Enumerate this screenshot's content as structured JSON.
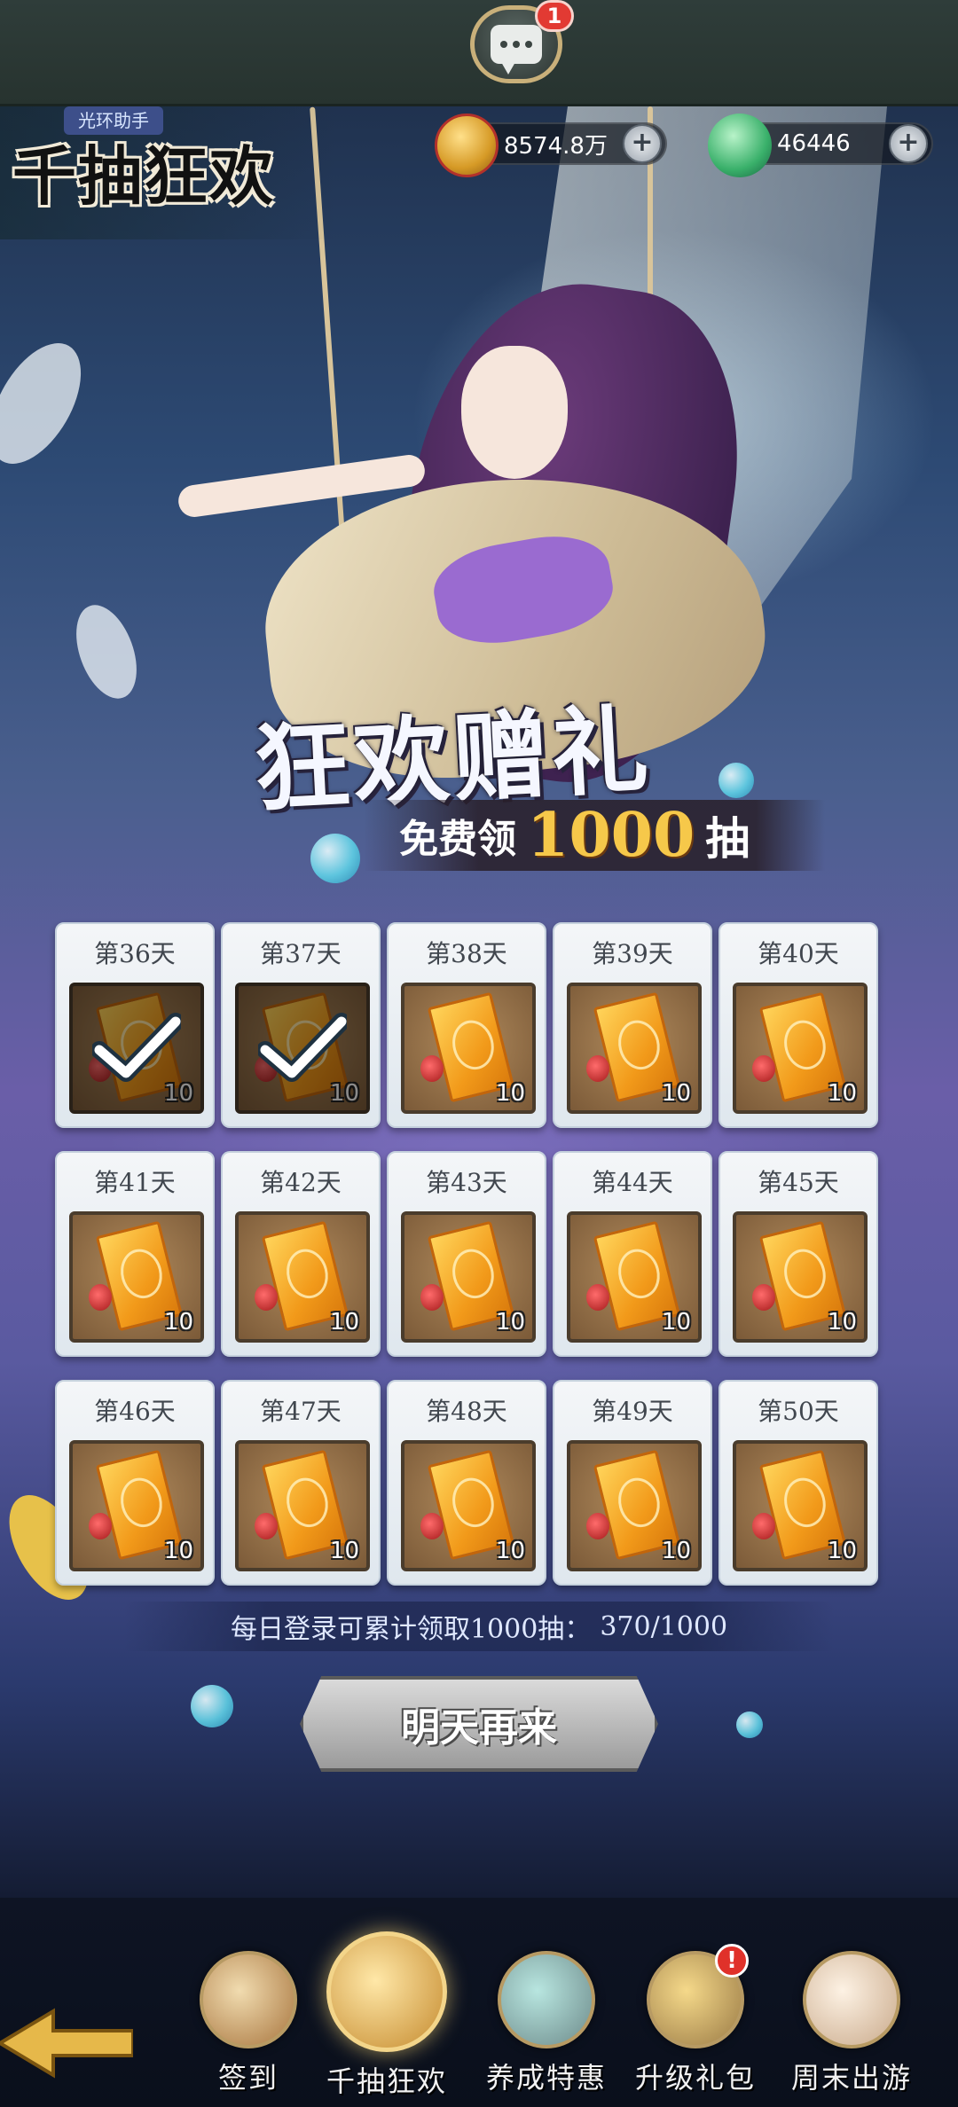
{
  "top_bar": {
    "chat_badge": "1"
  },
  "event": {
    "helper_tag": "光环助手",
    "title": "千抽狂欢"
  },
  "currencies": [
    {
      "name": "coin",
      "value": "8574.8万",
      "icon": "copper-coin-icon"
    },
    {
      "name": "jade",
      "value": "46446",
      "icon": "jade-icon"
    }
  ],
  "banner": {
    "main": "狂欢赠礼",
    "free_label": "免费领",
    "amount": "1000",
    "draw_label": "抽"
  },
  "days": [
    {
      "label": "第36天",
      "qty": "10",
      "claimed": true
    },
    {
      "label": "第37天",
      "qty": "10",
      "claimed": true
    },
    {
      "label": "第38天",
      "qty": "10",
      "claimed": false
    },
    {
      "label": "第39天",
      "qty": "10",
      "claimed": false
    },
    {
      "label": "第40天",
      "qty": "10",
      "claimed": false
    },
    {
      "label": "第41天",
      "qty": "10",
      "claimed": false
    },
    {
      "label": "第42天",
      "qty": "10",
      "claimed": false
    },
    {
      "label": "第43天",
      "qty": "10",
      "claimed": false
    },
    {
      "label": "第44天",
      "qty": "10",
      "claimed": false
    },
    {
      "label": "第45天",
      "qty": "10",
      "claimed": false
    },
    {
      "label": "第46天",
      "qty": "10",
      "claimed": false
    },
    {
      "label": "第47天",
      "qty": "10",
      "claimed": false
    },
    {
      "label": "第48天",
      "qty": "10",
      "claimed": false
    },
    {
      "label": "第49天",
      "qty": "10",
      "claimed": false
    },
    {
      "label": "第50天",
      "qty": "10",
      "claimed": false
    }
  ],
  "progress": {
    "text": "每日登录可累计领取1000抽：",
    "count": "370/1000"
  },
  "action_button": "明天再来",
  "nav": [
    {
      "label": "签到",
      "icon": "scroll-icon",
      "active": false,
      "badge": ""
    },
    {
      "label": "千抽狂欢",
      "icon": "treasure-chest-icon",
      "active": true,
      "badge": ""
    },
    {
      "label": "养成特惠",
      "icon": "chest-icon",
      "active": false,
      "badge": ""
    },
    {
      "label": "升级礼包",
      "icon": "coin-pot-icon",
      "active": false,
      "badge": "!"
    },
    {
      "label": "周末出游",
      "icon": "landscape-icon",
      "active": false,
      "badge": ""
    }
  ],
  "colors": {
    "accent_gold": "#f6c84a",
    "badge_red": "#e23a33",
    "card_bg": "#f4f6f8"
  }
}
